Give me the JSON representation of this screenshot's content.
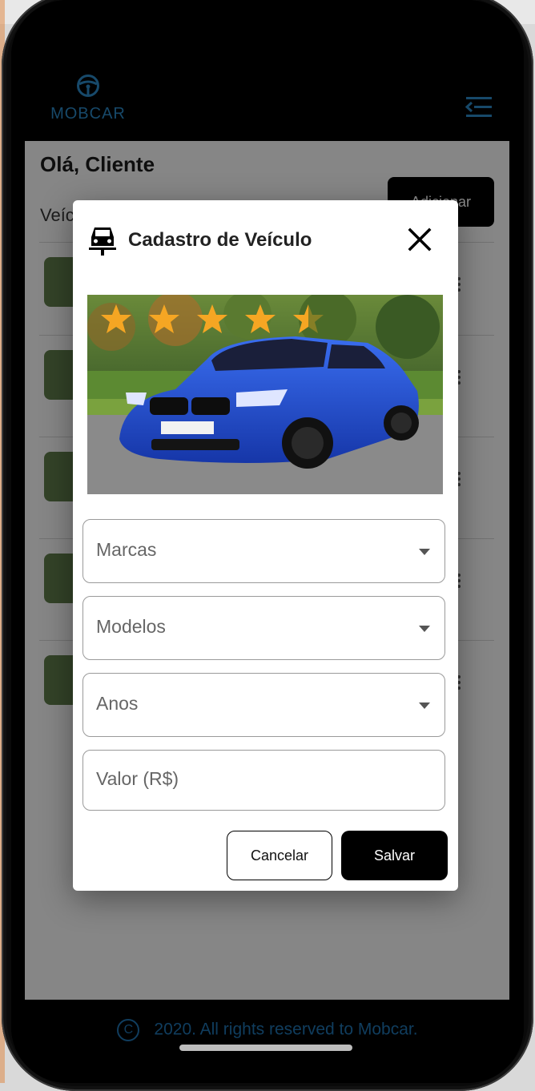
{
  "app": {
    "brand": "MOBCAR"
  },
  "page": {
    "greeting": "Olá, Cliente",
    "section_label": "Veíc",
    "add_button": "Adicionar"
  },
  "modal": {
    "title": "Cadastro de Veículo",
    "rating": 4.5,
    "rating_max": 5,
    "fields": {
      "brand_placeholder": "Marcas",
      "model_placeholder": "Modelos",
      "year_placeholder": "Anos",
      "value_placeholder": "Valor (R$)"
    },
    "cancel_label": "Cancelar",
    "save_label": "Salvar"
  },
  "footer": {
    "text": "2020. All rights reserved to Mobcar."
  },
  "colors": {
    "brand": "#2a86c2",
    "footer_text": "#1e6fab",
    "star": "#f5a623",
    "car_blue": "#1f4fd0"
  }
}
